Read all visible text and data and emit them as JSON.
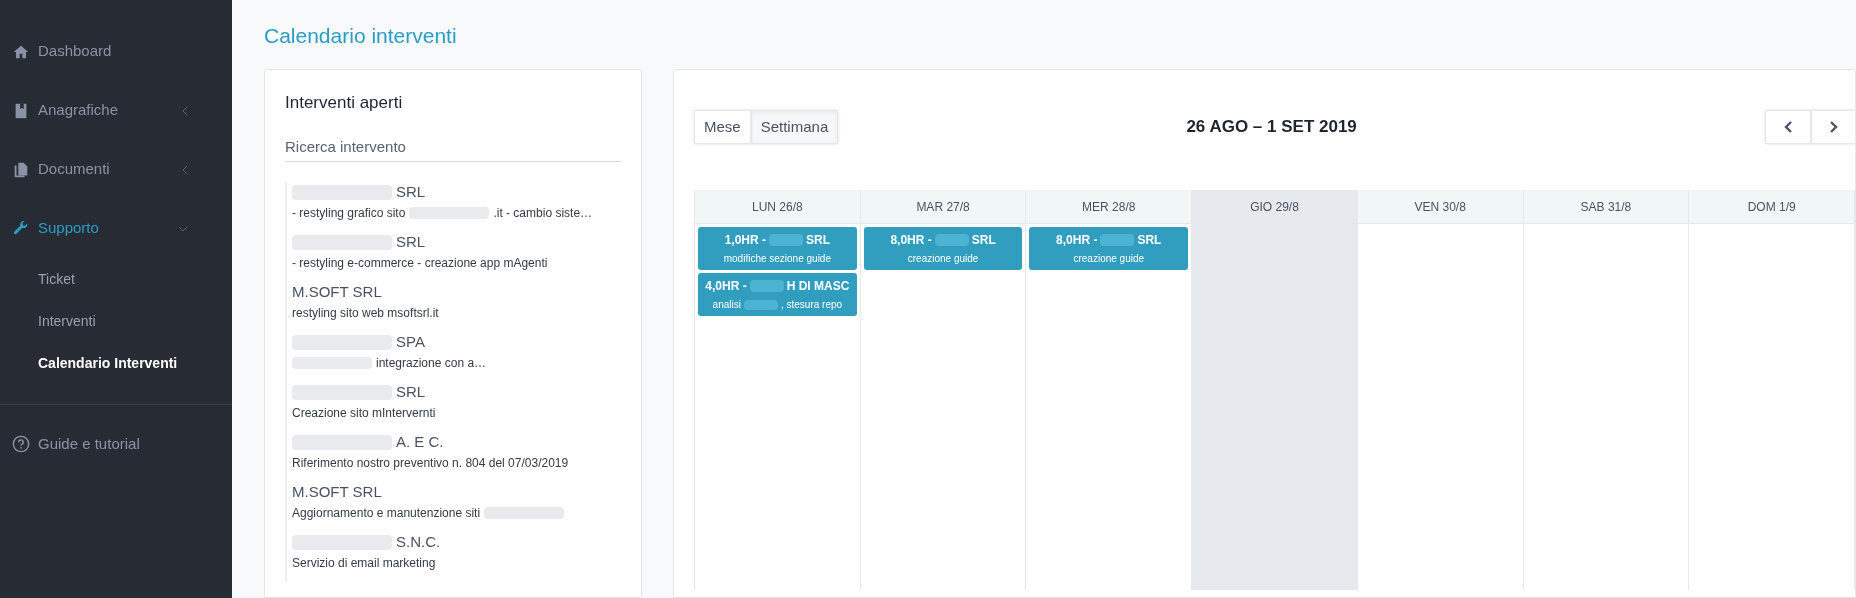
{
  "sidebar": {
    "items": [
      {
        "label": "Dashboard",
        "selected": false,
        "expandable": false
      },
      {
        "label": "Anagrafiche",
        "selected": false,
        "expandable": true,
        "expanded": false
      },
      {
        "label": "Documenti",
        "selected": false,
        "expandable": true,
        "expanded": false
      },
      {
        "label": "Supporto",
        "selected": true,
        "expandable": true,
        "expanded": true,
        "children": [
          {
            "label": "Ticket",
            "selected": false
          },
          {
            "label": "Interventi",
            "selected": false
          },
          {
            "label": "Calendario Interventi",
            "selected": true
          }
        ]
      }
    ],
    "footer_item": {
      "label": "Guide e tutorial"
    }
  },
  "page_title": "Calendario interventi",
  "open_panel": {
    "title": "Interventi aperti",
    "search": {
      "placeholder": "Ricerca intervento"
    },
    "items": [
      {
        "title": [
          {
            "kind": "blur"
          },
          {
            "kind": "text",
            "text": "SRL"
          }
        ],
        "description": [
          {
            "kind": "text",
            "text": "- restyling grafico sito"
          },
          {
            "kind": "blur"
          },
          {
            "kind": "text",
            "text": ".it - cambio siste…"
          }
        ]
      },
      {
        "title": [
          {
            "kind": "blur"
          },
          {
            "kind": "text",
            "text": "SRL"
          }
        ],
        "description": [
          {
            "kind": "text",
            "text": "- restyling e-commerce - creazione app mAgenti"
          }
        ]
      },
      {
        "title": [
          {
            "kind": "text",
            "text": "M.SOFT SRL"
          }
        ],
        "description": [
          {
            "kind": "text",
            "text": "restyling sito web msoftsrl.it"
          }
        ]
      },
      {
        "title": [
          {
            "kind": "blur"
          },
          {
            "kind": "text",
            "text": "SPA"
          }
        ],
        "description": [
          {
            "kind": "blur"
          },
          {
            "kind": "text",
            "text": "integrazione con a…"
          }
        ]
      },
      {
        "title": [
          {
            "kind": "blur"
          },
          {
            "kind": "text",
            "text": "SRL"
          }
        ],
        "description": [
          {
            "kind": "text",
            "text": "Creazione sito mIntervernti"
          }
        ]
      },
      {
        "title": [
          {
            "kind": "blur"
          },
          {
            "kind": "text",
            "text": "A. E C."
          }
        ],
        "description": [
          {
            "kind": "text",
            "text": "Riferimento nostro preventivo n. 804 del 07/03/2019"
          }
        ]
      },
      {
        "title": [
          {
            "kind": "text",
            "text": "M.SOFT SRL"
          }
        ],
        "description": [
          {
            "kind": "text",
            "text": "Aggiornamento e manutenzione siti"
          },
          {
            "kind": "blur"
          }
        ]
      },
      {
        "title": [
          {
            "kind": "blur"
          },
          {
            "kind": "text",
            "text": "S.N.C."
          }
        ],
        "description": [
          {
            "kind": "text",
            "text": "Servizio di email marketing"
          }
        ]
      }
    ]
  },
  "calendar": {
    "views": [
      {
        "label": "Mese",
        "selected": false
      },
      {
        "label": "Settimana",
        "selected": true
      }
    ],
    "range_title": "26 AGO – 1 SET 2019",
    "days": [
      {
        "label": "LUN 26/8",
        "today": false,
        "events": [
          {
            "title": [
              {
                "kind": "text",
                "text": "1,0HR -"
              },
              {
                "kind": "blur"
              },
              {
                "kind": "text",
                "text": "SRL"
              }
            ],
            "description": [
              {
                "kind": "text",
                "text": "modifiche sezione guide"
              }
            ]
          },
          {
            "title": [
              {
                "kind": "text",
                "text": "4,0HR -"
              },
              {
                "kind": "blur"
              },
              {
                "kind": "text",
                "text": "H DI MASC"
              }
            ],
            "description": [
              {
                "kind": "text",
                "text": "analisi"
              },
              {
                "kind": "blur"
              },
              {
                "kind": "text",
                "text": ", stesura repo"
              }
            ]
          }
        ]
      },
      {
        "label": "MAR 27/8",
        "today": false,
        "events": [
          {
            "title": [
              {
                "kind": "text",
                "text": "8,0HR -"
              },
              {
                "kind": "blur"
              },
              {
                "kind": "text",
                "text": "SRL"
              }
            ],
            "description": [
              {
                "kind": "text",
                "text": "creazione guide"
              }
            ]
          }
        ]
      },
      {
        "label": "MER 28/8",
        "today": false,
        "events": [
          {
            "title": [
              {
                "kind": "text",
                "text": "8,0HR -"
              },
              {
                "kind": "blur"
              },
              {
                "kind": "text",
                "text": "SRL"
              }
            ],
            "description": [
              {
                "kind": "text",
                "text": "creazione guide"
              }
            ]
          }
        ]
      },
      {
        "label": "GIO 29/8",
        "today": true
      },
      {
        "label": "VEN 30/8",
        "today": false
      },
      {
        "label": "SAB 31/8",
        "today": false
      },
      {
        "label": "DOM 1/9",
        "today": false
      }
    ]
  }
}
